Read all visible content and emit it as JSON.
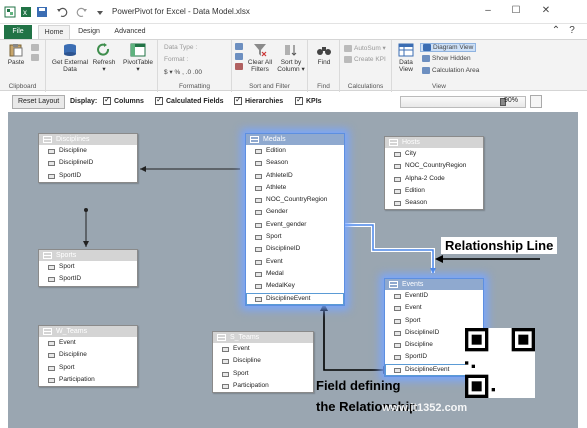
{
  "window": {
    "title": "PowerPivot for Excel - Data Model.xlsx",
    "minimize": "–",
    "maximize": "☐",
    "close": "✕",
    "help": "?",
    "collapse": "⌃"
  },
  "tabs": {
    "file": "File",
    "home": "Home",
    "design": "Design",
    "advanced": "Advanced"
  },
  "ribbon": {
    "clipboard": {
      "label": "Clipboard",
      "paste": "Paste"
    },
    "get_external": {
      "line1": "Get External",
      "line2": "Data"
    },
    "refresh": {
      "line1": "Refresh",
      "line2": "▾"
    },
    "pivottable": {
      "line1": "PivotTable",
      "line2": "▾"
    },
    "formatting": {
      "label": "Formatting",
      "data_type": "Data Type :",
      "format": "Format :",
      "symbols": "$ ▾ %  ,  .0  .00"
    },
    "sort_filter": {
      "label": "Sort and Filter",
      "clear_all": "Clear All",
      "filters": "Filters",
      "sort_by": "Sort by",
      "column": "Column ▾"
    },
    "find": {
      "label": "Find",
      "find": "Find"
    },
    "calculations": {
      "label": "Calculations",
      "autosum": "AutoSum ▾",
      "create_kpi": "Create KPI"
    },
    "view": {
      "label": "View",
      "data": "Data",
      "view": "View",
      "diagram_view": "Diagram View",
      "show_hidden": "Show Hidden",
      "calc_area": "Calculation Area"
    }
  },
  "toolbar": {
    "reset_layout": "Reset Layout",
    "display": "Display:",
    "columns": "Columns",
    "calculated_fields": "Calculated Fields",
    "hierarchies": "Hierarchies",
    "kpis": "KPIs",
    "zoom": "90%",
    "zoom_fraction": 0.9
  },
  "tables": {
    "disciplines": {
      "name": "Disciplines",
      "fields": [
        "Discipline",
        "DisciplineID",
        "SportID"
      ]
    },
    "sports": {
      "name": "Sports",
      "fields": [
        "Sport",
        "SportID"
      ]
    },
    "w_teams": {
      "name": "W_Teams",
      "fields": [
        "Event",
        "Discipline",
        "Sport",
        "Participation"
      ]
    },
    "medals": {
      "name": "Medals",
      "fields": [
        "Edition",
        "Season",
        "AthleteID",
        "Athlete",
        "NOC_CountryRegion",
        "Gender",
        "Event_gender",
        "Sport",
        "DisciplineID",
        "Event",
        "Medal",
        "MedalKey",
        "DisciplineEvent"
      ]
    },
    "s_teams": {
      "name": "S_Teams",
      "fields": [
        "Event",
        "Discipline",
        "Sport",
        "Participation"
      ]
    },
    "hosts": {
      "name": "Hosts",
      "fields": [
        "City",
        "NOC_CountryRegion",
        "Alpha-2 Code",
        "Edition",
        "Season"
      ]
    },
    "events": {
      "name": "Events",
      "fields": [
        "EventID",
        "Event",
        "Sport",
        "DisciplineID",
        "Discipline",
        "SportID",
        "DisciplineEvent"
      ]
    }
  },
  "annotations": {
    "relationship_line": "Relationship Line",
    "field_defining_1": "Field defining",
    "field_defining_2": "the Relationship"
  },
  "watermark": "www.it1352.com",
  "colors": {
    "excel_green": "#217346",
    "canvas": "#9aa6b1",
    "highlight": "#78a5ff",
    "relationship": "#4a86e8"
  }
}
